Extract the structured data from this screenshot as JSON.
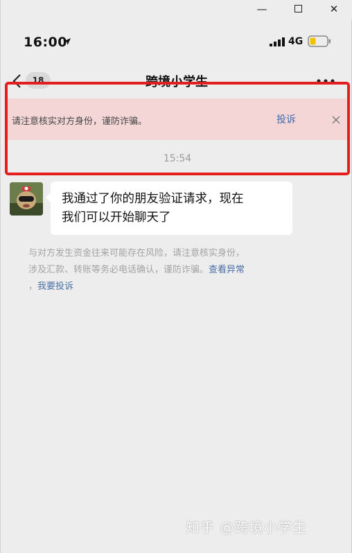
{
  "window": {
    "minimize_glyph": "—",
    "close_glyph": "✕"
  },
  "status_bar": {
    "time": "16:00",
    "network": "4G"
  },
  "nav": {
    "unread_count": "18",
    "title": "跨境小学生"
  },
  "warning_banner": {
    "text": "请注意核实对方身份，谨防诈骗。",
    "report_label": "投诉"
  },
  "timestamp": "15:54",
  "message": {
    "line1": "我通过了你的朋友验证请求，现在",
    "line2": "我们可以开始聊天了"
  },
  "notice": {
    "line1": "与对方发生资金往来可能存在风险，请注意核实身份，",
    "line2_text": "涉及汇款、转账等务必电话确认，谨防诈骗。",
    "line2_link": "查看异常",
    "line3_prefix": "，",
    "line3_link": "我要投诉"
  },
  "watermark": "知乎 @跨境小学生",
  "colors": {
    "highlight_border": "#e41e1e",
    "warning_bg": "#f4d6d6",
    "link": "#3e6ab0",
    "chat_bg": "#ededed"
  },
  "icons": [
    "minimize-icon",
    "maximize-icon",
    "close-window-icon",
    "location-arrow-icon",
    "signal-icon",
    "battery-icon",
    "back-chevron-icon",
    "more-dots-icon",
    "close-banner-icon"
  ]
}
